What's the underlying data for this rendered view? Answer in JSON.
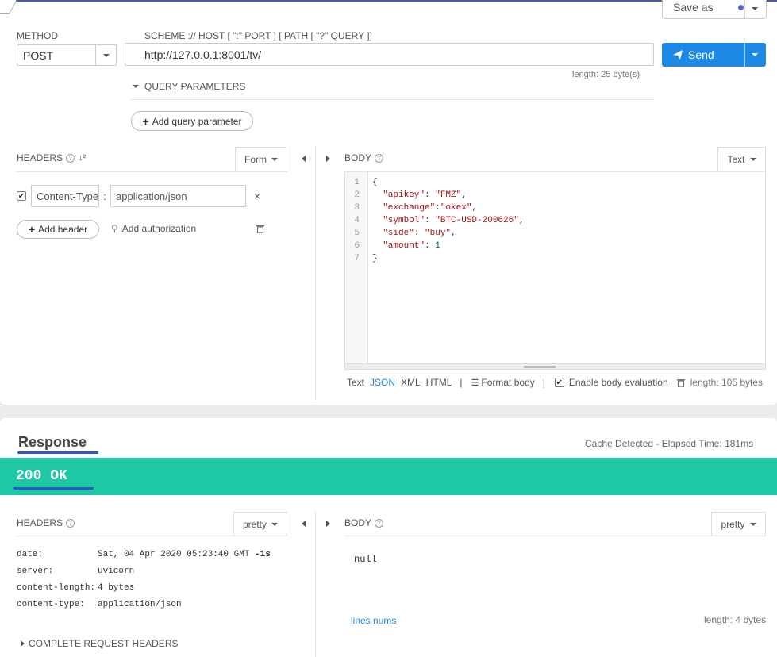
{
  "request": {
    "method_label": "METHOD",
    "method_value": "POST",
    "url_label": "SCHEME :// HOST [ \":\" PORT ] [ PATH [ \"?\" QUERY ]]",
    "url_value": "http://127.0.0.1:8001/tv/",
    "url_length": "length: 25 byte(s)",
    "send_label": "Send",
    "save_as_label": "Save as",
    "query_params_label": "QUERY PARAMETERS",
    "add_query_param_label": "Add query parameter"
  },
  "headers": {
    "title": "HEADERS",
    "form_label": "Form",
    "header_key": "Content-Type",
    "header_sep": ":",
    "header_value": "application/json",
    "add_header_label": "Add header",
    "add_auth_label": "Add authorization"
  },
  "body": {
    "title": "BODY",
    "type_label": "Text",
    "code_lines": [
      {
        "num": "1",
        "parts": [
          {
            "t": "{",
            "c": "p"
          }
        ]
      },
      {
        "num": "2",
        "parts": [
          {
            "t": "  \"apikey\"",
            "c": "k"
          },
          {
            "t": ": ",
            "c": "p"
          },
          {
            "t": "\"FMZ\"",
            "c": "k"
          },
          {
            "t": ",",
            "c": "p"
          }
        ]
      },
      {
        "num": "3",
        "parts": [
          {
            "t": "  \"exchange\"",
            "c": "k"
          },
          {
            "t": ":",
            "c": "p"
          },
          {
            "t": "\"okex\"",
            "c": "k"
          },
          {
            "t": ",",
            "c": "p"
          }
        ]
      },
      {
        "num": "4",
        "parts": [
          {
            "t": "  \"symbol\"",
            "c": "k"
          },
          {
            "t": ": ",
            "c": "p"
          },
          {
            "t": "\"BTC-USD-200626\"",
            "c": "k"
          },
          {
            "t": ",",
            "c": "p"
          }
        ]
      },
      {
        "num": "5",
        "parts": [
          {
            "t": "  \"side\"",
            "c": "k"
          },
          {
            "t": ": ",
            "c": "p"
          },
          {
            "t": "\"buy\"",
            "c": "k"
          },
          {
            "t": ",",
            "c": "p"
          }
        ]
      },
      {
        "num": "6",
        "parts": [
          {
            "t": "  \"amount\"",
            "c": "k"
          },
          {
            "t": ": ",
            "c": "p"
          },
          {
            "t": "1",
            "c": "n"
          }
        ]
      },
      {
        "num": "7",
        "parts": [
          {
            "t": "}",
            "c": "p"
          }
        ]
      }
    ],
    "fmt_text": "Text",
    "fmt_json": "JSON",
    "fmt_xml": "XML",
    "fmt_html": "HTML",
    "sep": "|",
    "format_body_label": "Format body",
    "enable_eval_label": "Enable body evaluation",
    "length": "length: 105 bytes"
  },
  "response": {
    "title": "Response",
    "cache_info": "Cache Detected - Elapsed Time: 181ms",
    "status": "200 OK",
    "headers_title": "HEADERS",
    "headers_mode": "pretty",
    "headers": [
      {
        "key": "date:",
        "value": "Sat, 04 Apr 2020 05:23:40 GMT ",
        "extra": "-1s"
      },
      {
        "key": "server:",
        "value": "uvicorn",
        "extra": ""
      },
      {
        "key": "content-length:",
        "value": "4 bytes",
        "extra": ""
      },
      {
        "key": "content-type:",
        "value": "application/json",
        "extra": ""
      }
    ],
    "complete_headers_label": "COMPLETE REQUEST HEADERS",
    "body_title": "BODY",
    "body_mode": "pretty",
    "body_value": "null",
    "lines_nums_label": "lines nums",
    "body_length": "length: 4 bytes"
  },
  "colors": {
    "accent": "#1e88e5",
    "status_bg": "#1ec8a5",
    "underline": "#3355cc"
  }
}
